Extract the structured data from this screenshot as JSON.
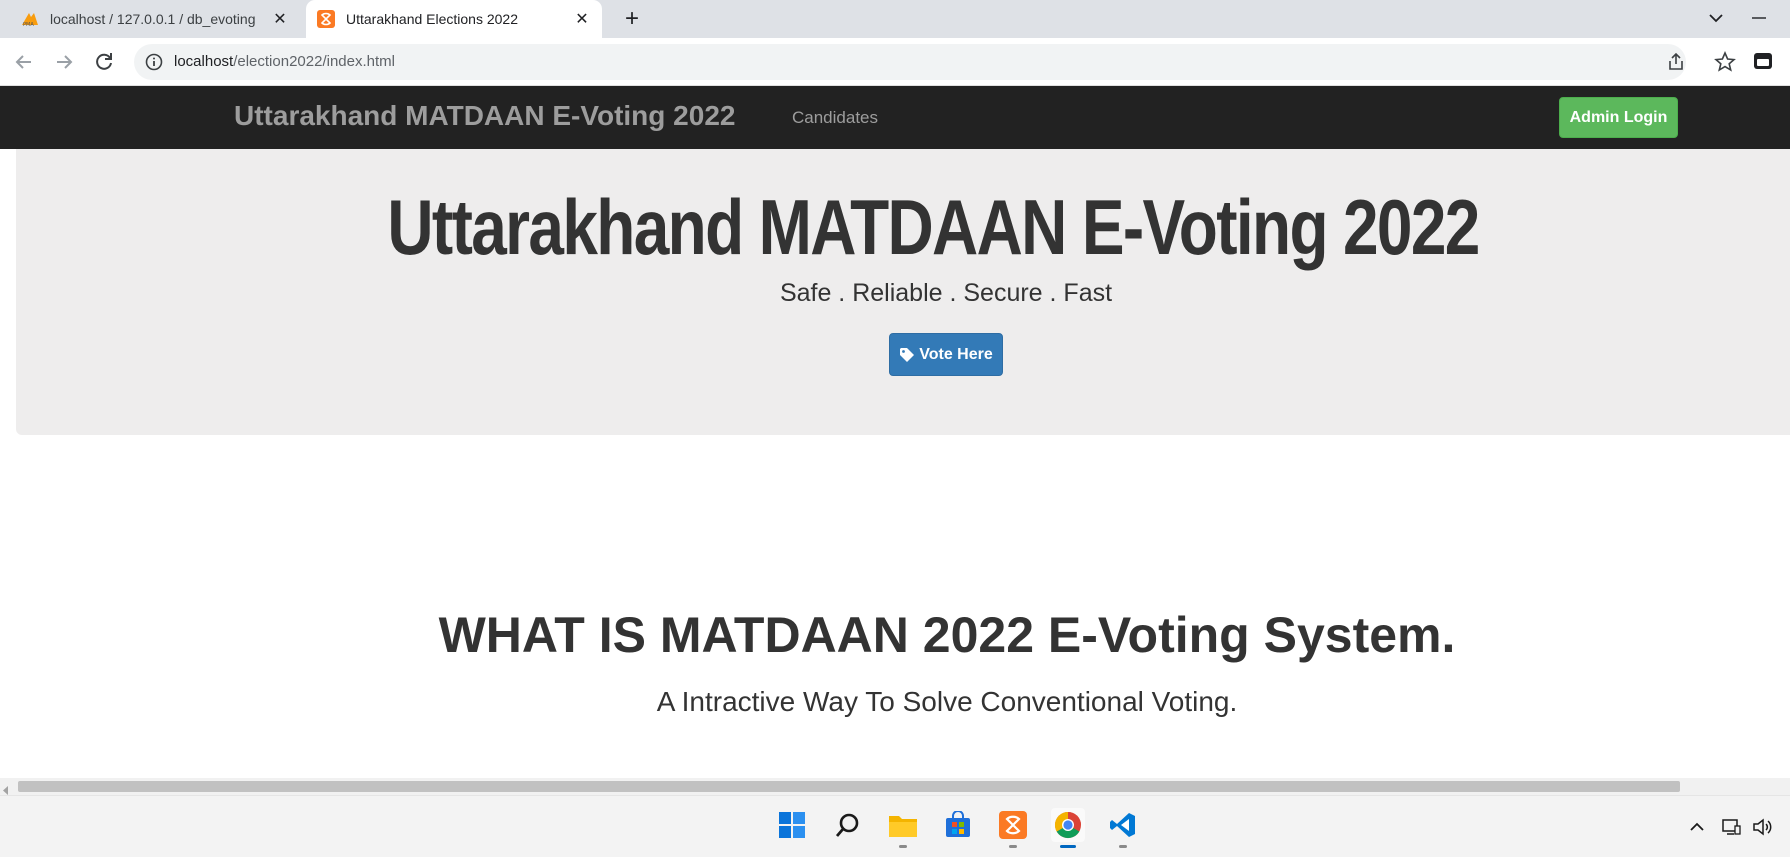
{
  "browser": {
    "tabs": [
      {
        "title": "localhost / 127.0.0.1 / db_evoting",
        "favicon": "phpmyadmin-icon",
        "active": false
      },
      {
        "title": "Uttarakhand Elections 2022",
        "favicon": "xampp-icon",
        "active": true
      }
    ],
    "url_host": "localhost",
    "url_path": "/election2022/index.html"
  },
  "page": {
    "navbar": {
      "brand": "Uttarakhand MATDAAN E-Voting 2022",
      "links": [
        "Candidates"
      ],
      "admin_button": "Admin Login"
    },
    "hero": {
      "title": "Uttarakhand MATDAAN E-Voting 2022",
      "tagline": "Safe . Reliable . Secure . Fast",
      "vote_button": "Vote Here"
    },
    "about": {
      "title": "WHAT IS MATDAAN 2022 E-Voting System.",
      "subtitle": "A Intractive Way To Solve Conventional Voting."
    }
  },
  "taskbar": {
    "apps": [
      "windows-start-icon",
      "search-icon",
      "file-explorer-icon",
      "microsoft-store-icon",
      "xampp-icon",
      "chrome-icon",
      "vscode-icon"
    ]
  },
  "colors": {
    "navbar_bg": "#222222",
    "jumbotron_bg": "#eeeded",
    "admin_button": "#5cb85c",
    "vote_button": "#337ab7"
  }
}
